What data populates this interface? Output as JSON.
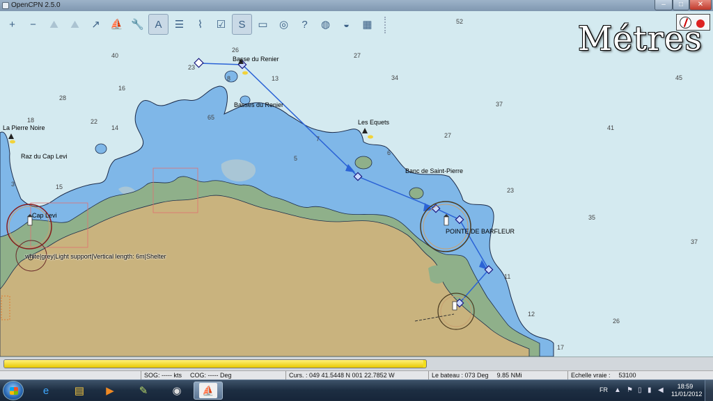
{
  "window": {
    "title": "OpenCPN 2.5.0",
    "min_glyph": "–",
    "max_glyph": "□",
    "close_glyph": "✕"
  },
  "toolbar": [
    {
      "name": "zoom-in",
      "glyph": "+"
    },
    {
      "name": "zoom-out",
      "glyph": "−"
    },
    {
      "name": "scale-in",
      "glyph": "⛰",
      "dim": true
    },
    {
      "name": "scale-out",
      "glyph": "⛰",
      "dim": true
    },
    {
      "name": "route",
      "glyph": "↗"
    },
    {
      "name": "auto-follow",
      "glyph": "⛵"
    },
    {
      "name": "settings",
      "glyph": "🔧"
    },
    {
      "name": "text",
      "glyph": "A",
      "active": true
    },
    {
      "name": "route-manager",
      "glyph": "☰"
    },
    {
      "name": "tides",
      "glyph": "⌇"
    },
    {
      "name": "currents",
      "glyph": "☑"
    },
    {
      "name": "chart-outlines",
      "glyph": "S",
      "active": true
    },
    {
      "name": "color-scheme",
      "glyph": "▭"
    },
    {
      "name": "man-overboard",
      "glyph": "◎"
    },
    {
      "name": "help",
      "glyph": "?"
    },
    {
      "name": "plugin-grib",
      "glyph": "◍"
    },
    {
      "name": "plugin-world",
      "glyph": "◒"
    },
    {
      "name": "plugin-dashboard",
      "glyph": "▦"
    }
  ],
  "units_overlay": "Métres",
  "chart": {
    "places": [
      {
        "id": "basse-renier",
        "label": "Basse du Renier"
      },
      {
        "id": "basses-renier",
        "label": "Basses du Renier"
      },
      {
        "id": "la-pierre-noire",
        "label": "La Pierre Noire"
      },
      {
        "id": "raz-cap-levi",
        "label": "Raz du Cap Levi"
      },
      {
        "id": "les-equets",
        "label": "Les Equets"
      },
      {
        "id": "banc-saint-pierre",
        "label": "Banc de Saint-Pierre"
      },
      {
        "id": "cap-levi",
        "label": "Cap Levi"
      },
      {
        "id": "pointe-barfleur",
        "label": "POINTE DE BARFLEUR"
      }
    ],
    "soundings": [
      "52",
      "26",
      "27",
      "34",
      "45",
      "40",
      "23",
      "8",
      "13",
      "28",
      "16",
      "18",
      "22",
      "14",
      "65",
      "37",
      "41",
      "27",
      "6",
      "5",
      "3",
      "15",
      "23",
      "35",
      "37",
      "11",
      "12",
      "26",
      "17",
      "7"
    ],
    "object_info": "white|grey|Light support|Vertical length: 6m|Shelter"
  },
  "progress": {
    "fraction": 0.993
  },
  "status": {
    "sog": "SOG: ----- kts",
    "cog": "COG: ----- Deg",
    "curs": "Curs. : 049 41.5448 N 001 22.7852 W",
    "bateau_label": "Le bateau : 073 Deg",
    "bateau_dist": "9.85 NMi",
    "echelle_label": "Echelle vraie :",
    "echelle_value": "53100"
  },
  "taskbar": {
    "language": "FR",
    "time": "18:59",
    "date": "11/01/2012"
  },
  "colors": {
    "land": "#c9b37e",
    "shallow": "#7fb7e8",
    "deep": "#d4eaf0",
    "intertidal": "#8fb08a",
    "route": "#2b63d6",
    "progress": "#f3df1c"
  }
}
